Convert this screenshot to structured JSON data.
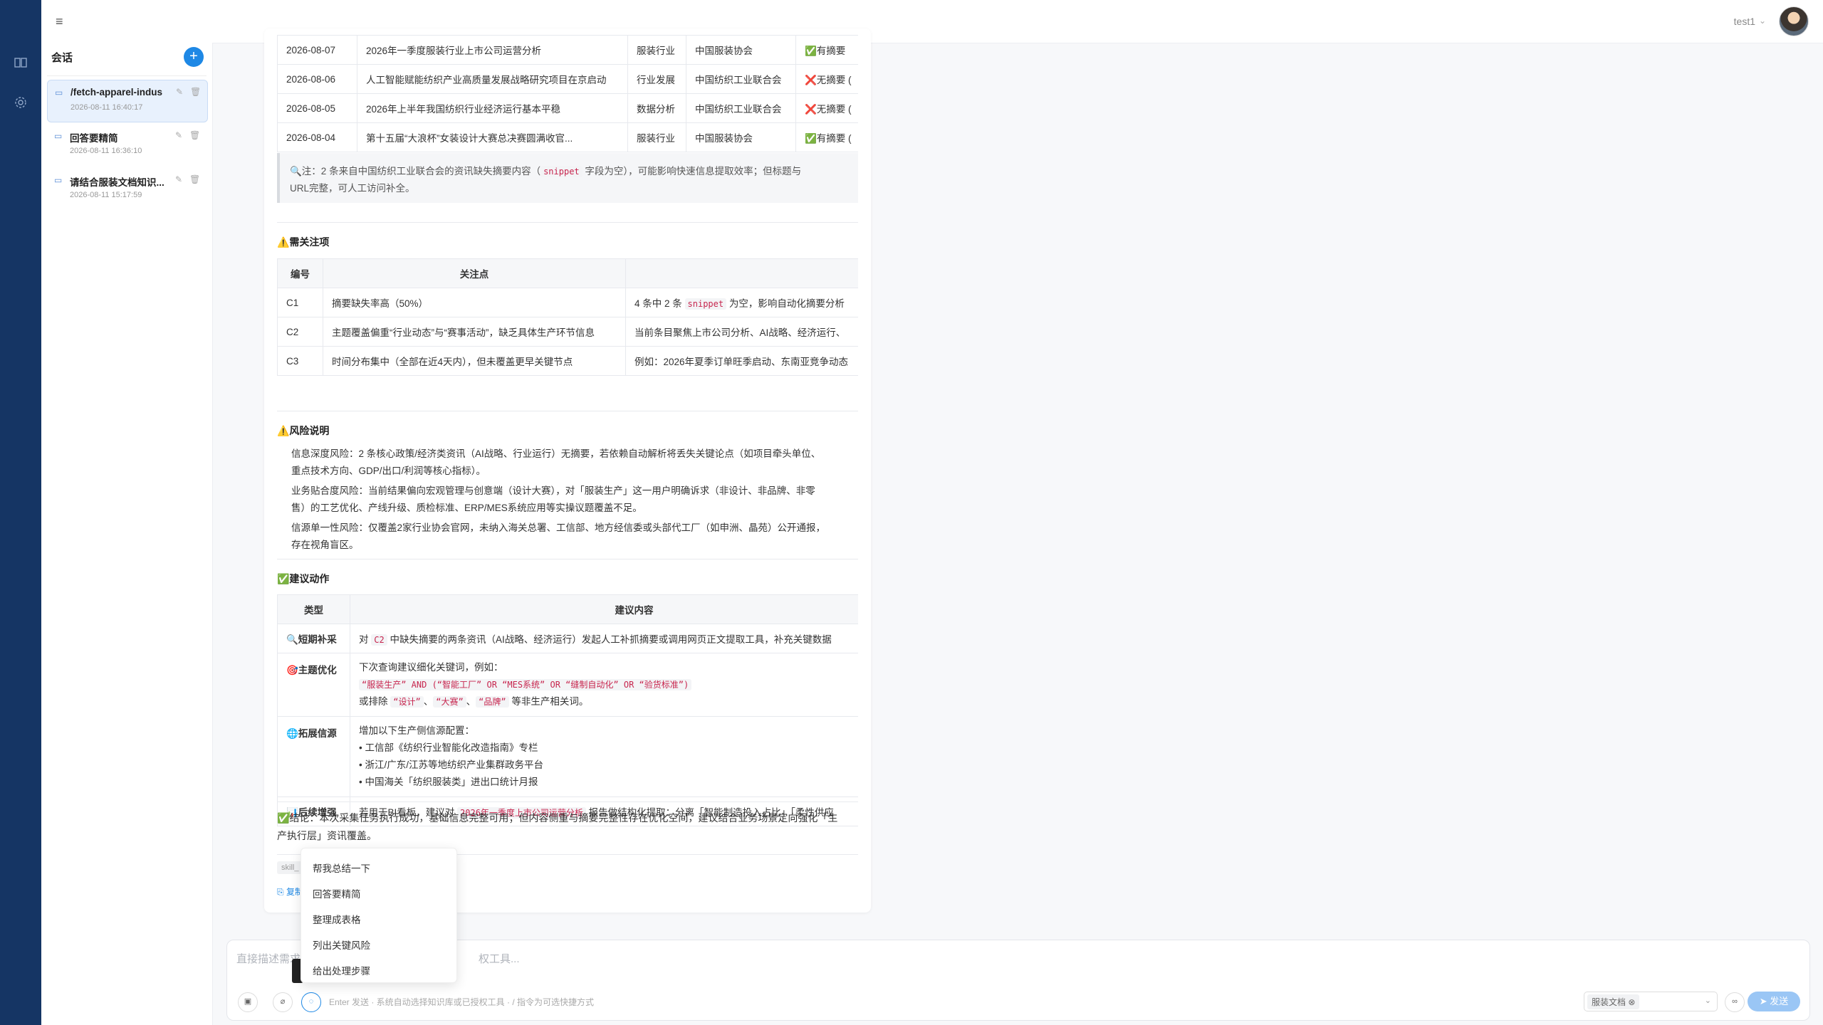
{
  "header": {
    "user": "test1",
    "menu_icon": "hamburger-icon",
    "avatar": "user-avatar"
  },
  "rail": {
    "icons": [
      "book-icon",
      "gear-icon"
    ]
  },
  "sidebar": {
    "title": "会话",
    "add_label": "+",
    "conversations": [
      {
        "title": "/fetch-apparel-indus",
        "date": "2026-08-11 16:40:17",
        "active": true
      },
      {
        "title": "回答要精简",
        "date": "2026-08-11 16:36:10",
        "active": false
      },
      {
        "title": "请结合服装文档知识...",
        "date": "2026-08-11 15:17:59",
        "active": false
      }
    ]
  },
  "news_table": {
    "rows": [
      [
        "2026-08-07",
        "2026年一季度服装行业上市公司运营分析",
        "服装行业",
        "中国服装协会",
        "✅有摘要"
      ],
      [
        "2026-08-06",
        "人工智能赋能纺织产业高质量发展战略研究项目在京启动",
        "行业发展",
        "中国纺织工业联合会",
        "❌无摘要 ("
      ],
      [
        "2026-08-05",
        "2026年上半年我国纺织行业经济运行基本平稳",
        "数据分析",
        "中国纺织工业联合会",
        "❌无摘要 ("
      ],
      [
        "2026-08-04",
        "第十五届“大浪杯”女装设计大赛总决赛圆满收官...",
        "服装行业",
        "中国服装协会",
        "✅有摘要 ("
      ]
    ]
  },
  "note": {
    "prefix": "🔍注：2 条来自中国纺织工业联合会的资讯缺失摘要内容（",
    "code": "snippet",
    "suffix": " 字段为空），可能影响快速信息提取效率；但标题与",
    "line2": "URL完整，可人工访问补全。"
  },
  "attention": {
    "heading": "⚠️需关注项",
    "headers": [
      "编号",
      "关注点",
      ""
    ],
    "rows": [
      {
        "id": "C1",
        "point": "摘要缺失率高（50%）",
        "detail_pre": "4 条中 2 条 ",
        "detail_code": "snippet",
        "detail_post": " 为空，影响自动化摘要分析"
      },
      {
        "id": "C2",
        "point": "主题覆盖偏重“行业动态”与“赛事活动”，缺乏具体生产环节信息",
        "detail_pre": "当前条目聚焦上市公司分析、AI战略、经济运行、",
        "detail_code": "",
        "detail_post": ""
      },
      {
        "id": "C3",
        "point": "时间分布集中（全部在近4天内），但未覆盖更早关键节点",
        "detail_pre": "例如：2026年夏季订单旺季启动、东南亚竞争动态",
        "detail_code": "",
        "detail_post": ""
      }
    ]
  },
  "risk": {
    "heading": "⚠️风险说明",
    "items": [
      {
        "line1": "信息深度风险：2 条核心政策/经济类资讯（AI战略、行业运行）无摘要，若依赖自动解析将丢失关键论点（如项目牵头单位、",
        "line2": "重点技术方向、GDP/出口/利润等核心指标）。"
      },
      {
        "line1": "业务贴合度风险：当前结果偏向宏观管理与创意端（设计大赛），对「服装生产」这一用户明确诉求（非设计、非品牌、非零",
        "line2": "售）的工艺优化、产线升级、质检标准、ERP/MES系统应用等实操议题覆盖不足。"
      },
      {
        "line1": "信源单一性风险：仅覆盖2家行业协会官网，未纳入海关总署、工信部、地方经信委或头部代工厂（如申洲、晶苑）公开通报，",
        "line2": "存在视角盲区。"
      }
    ]
  },
  "actions": {
    "heading": "✅建议动作",
    "headers": [
      "类型",
      "建议内容"
    ],
    "rows": [
      {
        "type": "🔍短期补采",
        "lines": [
          {
            "pre": "对 ",
            "code": "C2",
            "post": " 中缺失摘要的两条资讯（AI战略、经济运行）发起人工补抓摘要或调用网页正文提取工具，补充关键数据"
          }
        ]
      },
      {
        "type": "🎯主题优化",
        "lines": [
          {
            "pre": "下次查询建议细化关键词，例如：",
            "code": "",
            "post": ""
          },
          {
            "pre": "",
            "code": "“服装生产” AND (“智能工厂” OR “MES系统” OR “缝制自动化” OR “验货标准”)",
            "post": ""
          },
          {
            "pre": "或排除 ",
            "code": "“设计”",
            "post": "、",
            "code2": "“大赛”",
            "mid2": "、",
            "code3": "“品牌”",
            "post3": " 等非生产相关词。"
          }
        ]
      },
      {
        "type": "🌐拓展信源",
        "lines": [
          {
            "pre": "增加以下生产侧信源配置：",
            "code": "",
            "post": ""
          },
          {
            "pre": "• 工信部《纺织行业智能化改造指南》专栏",
            "code": "",
            "post": ""
          },
          {
            "pre": "• 浙江/广东/江苏等地纺织产业集群政务平台",
            "code": "",
            "post": ""
          },
          {
            "pre": "• 中国海关「纺织服装类」进出口统计月报",
            "code": "",
            "post": ""
          }
        ]
      },
      {
        "type": "📊后续增强",
        "lines": [
          {
            "pre": "若用于BI看板，建议对 ",
            "code": "2026年一季度上市公司运营分析",
            "post": " 报告做结构化提取：分离「智能制造投入占比」「柔性供应"
          }
        ]
      }
    ]
  },
  "conclusion": {
    "line1": "✅结论：本次采集任务执行成功，基础信息完整可用；但内容侧重与摘要完整性存在优化空间，建议结合业务场景定向强化「生",
    "line2": "产执行层」资讯覆盖。"
  },
  "footer": {
    "skill_tag": "skill_",
    "copy": "复制"
  },
  "quick_menu": {
    "items": [
      "帮我总结一下",
      "回答要精简",
      "整理成表格",
      "列出关键风险",
      "给出处理步骤"
    ]
  },
  "composer": {
    "placeholder_left": "直接描述需求",
    "placeholder_right": "权工具...",
    "hint": "Enter 发送 · 系统自动选择知识库或已授权工具 · / 指令为可选快捷方式",
    "kb_tag": "服装文档",
    "send": "➤ 发送",
    "icons": [
      "image-icon",
      "paperclip-icon",
      "chat-bubble-icon",
      "infinity-icon"
    ]
  }
}
